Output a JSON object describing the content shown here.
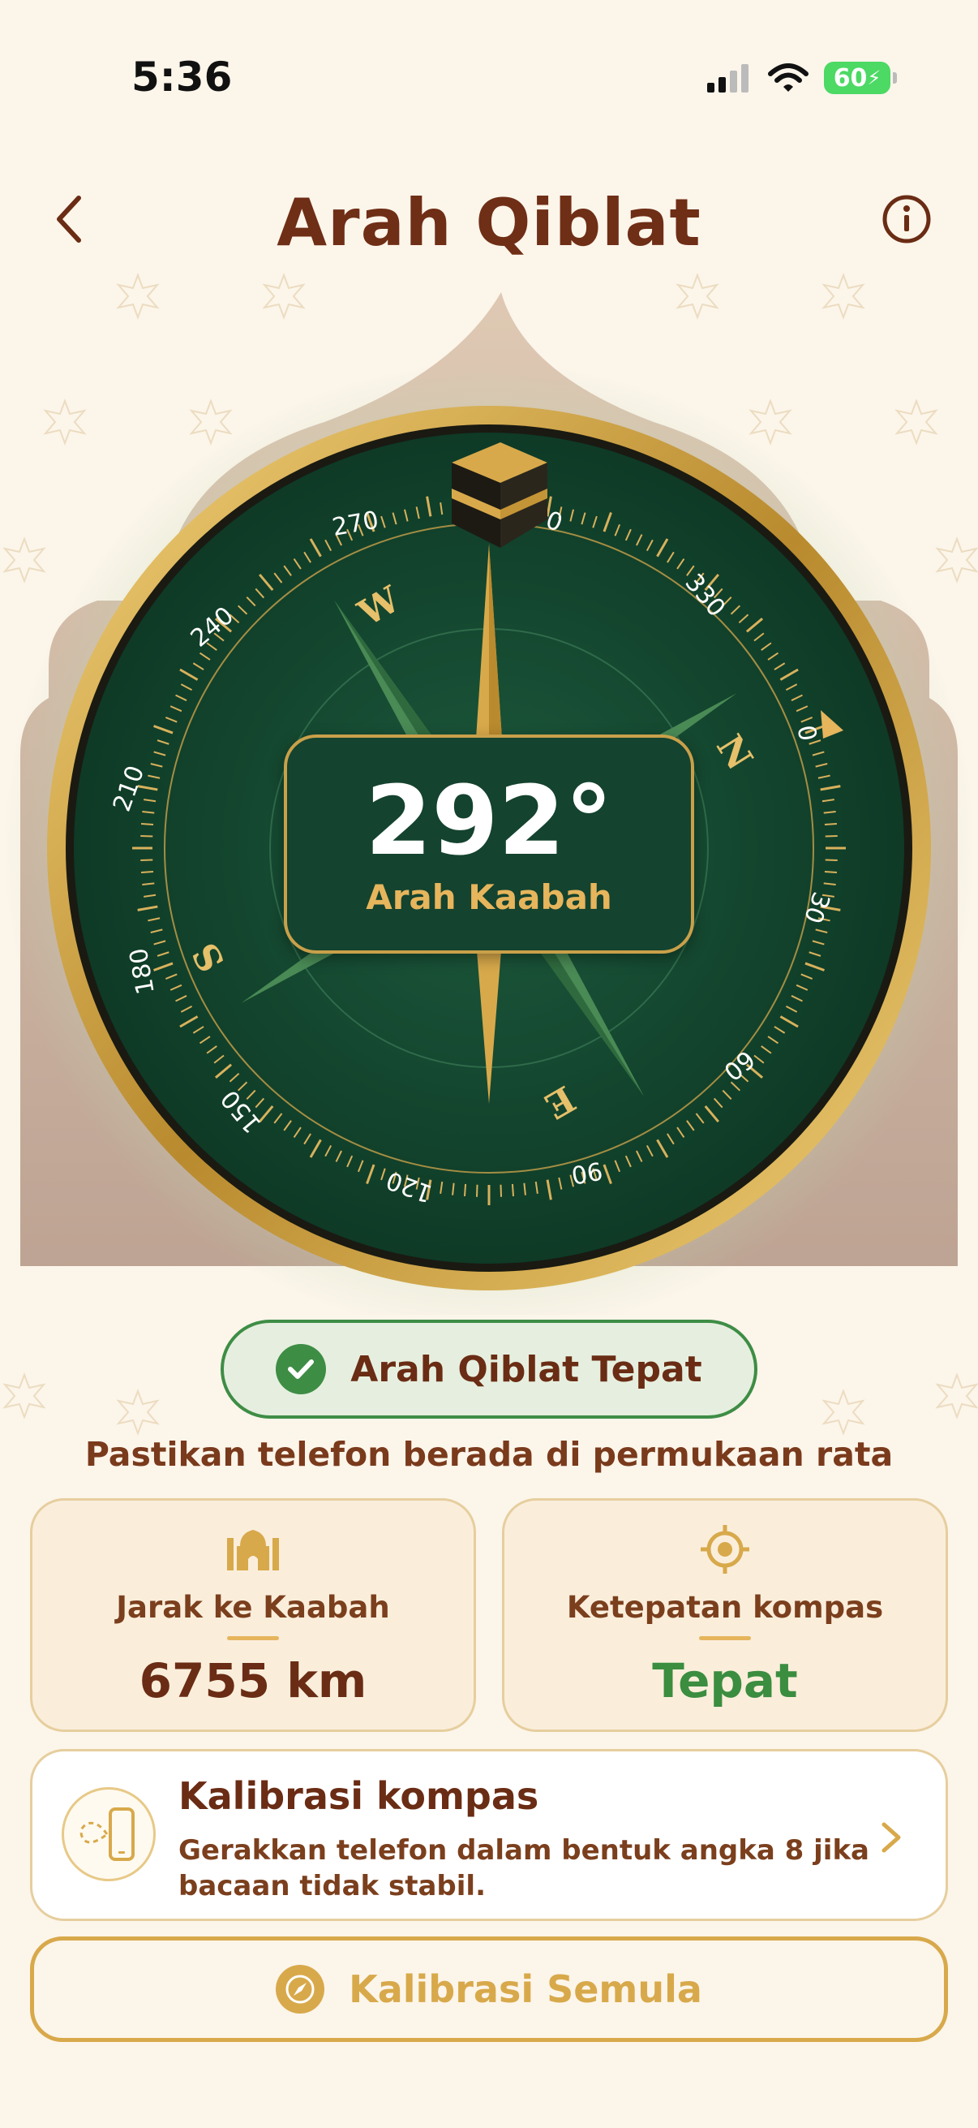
{
  "status_bar": {
    "time": "5:36",
    "battery": "60",
    "icons": [
      "cellular-signal-icon",
      "wifi-icon",
      "battery-charging-icon"
    ]
  },
  "header": {
    "title": "Arah Qiblat",
    "back_icon": "chevron-left-icon",
    "info_icon": "info-icon"
  },
  "compass": {
    "degree": "292°",
    "degree_label": "Arah Kaabah",
    "cardinals": [
      "N",
      "E",
      "S",
      "W"
    ],
    "dial_labels": [
      "0",
      "30",
      "60",
      "90",
      "120",
      "150",
      "180",
      "210",
      "240",
      "270",
      "330",
      "0"
    ],
    "kaabah_icon": "kaaba-icon",
    "colors": {
      "dial": "#15432f",
      "ring": "#d2a64a",
      "accent": "#e6b55c"
    }
  },
  "status": {
    "text": "Arah Qiblat Tepat",
    "icon": "check-circle-icon",
    "color": "#3e8d45"
  },
  "hint": "Pastikan telefon berada di permukaan rata",
  "cards": {
    "distance": {
      "icon": "mosque-icon",
      "label": "Jarak ke Kaabah",
      "value": "6755 km"
    },
    "accuracy": {
      "icon": "target-icon",
      "label": "Ketepatan kompas",
      "value": "Tepat"
    }
  },
  "calibration": {
    "icon": "phone-figure-eight-icon",
    "title": "Kalibrasi kompas",
    "description": "Gerakkan telefon dalam bentuk angka 8 jika bacaan tidak stabil.",
    "chevron_icon": "chevron-right-icon"
  },
  "reset_button": {
    "icon": "compass-icon",
    "label": "Kalibrasi Semula"
  }
}
